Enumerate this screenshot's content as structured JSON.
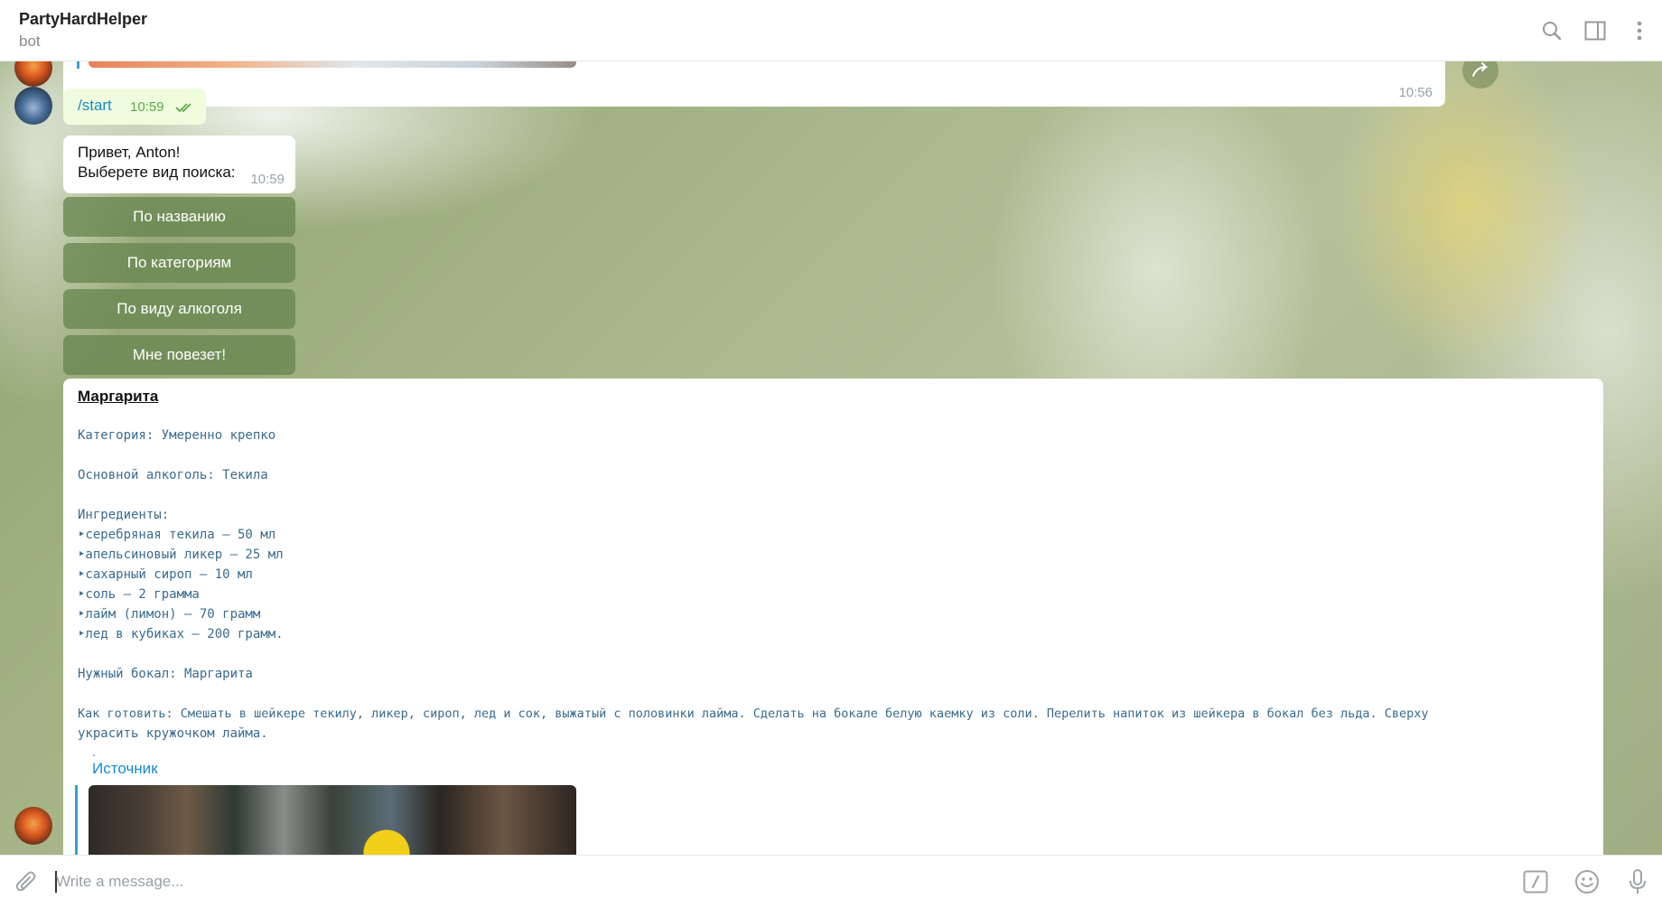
{
  "header": {
    "title": "PartyHardHelper",
    "subtitle": "bot"
  },
  "messages": {
    "top_card_time": "10:56",
    "outgoing": {
      "text": "/start",
      "time": "10:59"
    },
    "greeting": {
      "line1": "Привет, Anton!",
      "line2": "Выберете вид поиска:",
      "time": "10:59"
    },
    "keyboard": [
      "По названию",
      "По категориям",
      "По виду алкоголя",
      "Мне повезет!"
    ],
    "recipe": {
      "title": "Маргарита",
      "category": "Категория: Умеренно крепко",
      "main_alcohol": "Основной алкоголь: Текила",
      "ingredients_header": "Ингредиенты:",
      "ingredients": [
        "‣серебряная текила – 50 мл",
        "‣апельсиновый ликер – 25 мл",
        "‣сахарный сироп – 10 мл",
        "‣соль – 2 грамма",
        "‣лайм (лимон) – 70 грамм",
        "‣лед в кубиках – 200 грамм."
      ],
      "glass": "Нужный бокал: Маргарита",
      "howto_line1": "Как готовить: Смешать в шейкере текилу, ликер, сироп, лед и сок, выжатый с половинки лайма. Сделать на бокале белую каемку из соли. Перелить напиток из шейкера в бокал без льда. Сверху",
      "howto_line2": "украсить кружочком лайма.",
      "dot": ".",
      "source": "Источник"
    }
  },
  "input": {
    "placeholder": "Write a message..."
  },
  "icons": {
    "header": [
      "search-icon",
      "sidebar-toggle-icon",
      "more-vertical-icon"
    ],
    "input": [
      "attach-icon",
      "bot-commands-icon",
      "emoji-icon",
      "microphone-icon"
    ]
  },
  "colors": {
    "accent": "#168acd",
    "outgoing_bubble": "#effdde",
    "keyboard_button": "#688550"
  }
}
